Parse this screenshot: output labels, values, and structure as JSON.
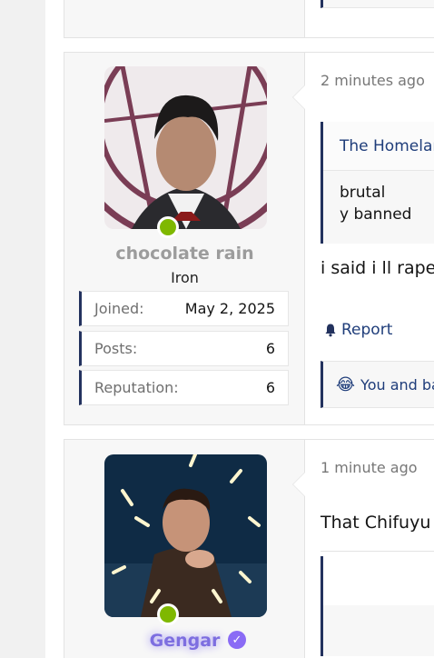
{
  "prev_post": {
    "reaction_fragment": "mentally_ill"
  },
  "post1": {
    "username": "chocolate rain",
    "user_title": "Iron",
    "stats": [
      {
        "label": "Joined:",
        "value": "May 2, 2025"
      },
      {
        "label": "Posts:",
        "value": "6"
      },
      {
        "label": "Reputation:",
        "value": "6"
      }
    ],
    "time": "2 minutes ago",
    "quote_author": "The Homelar",
    "quote_lines": [
      "brutal",
      "y banned"
    ],
    "body": "i said i ll rape",
    "report_label": "Report",
    "reaction_text": "You and ba",
    "reaction_emoji": "😂"
  },
  "post2": {
    "username": "Gengar",
    "time": "1 minute ago",
    "body": "That Chifuyu"
  },
  "colors": {
    "accent": "#23325e",
    "link": "#1f3d7a",
    "online": "#7fb800",
    "verified": "#8a6bf5"
  }
}
